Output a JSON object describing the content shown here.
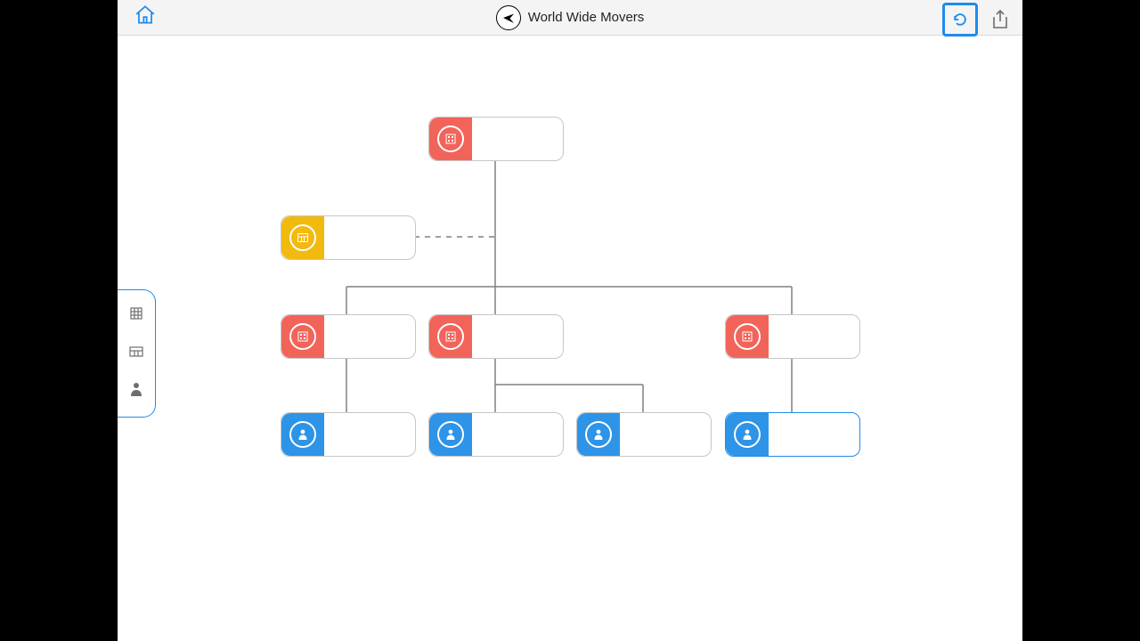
{
  "header": {
    "title": "World Wide Movers"
  },
  "palette": {
    "building_icon": "building-icon",
    "site_icon": "site-icon",
    "person_icon": "person-icon"
  },
  "nodes": {
    "root": {
      "type": "org",
      "color": "red",
      "label": ""
    },
    "assistant": {
      "type": "org",
      "color": "yellow",
      "label": ""
    },
    "dept_a": {
      "type": "org",
      "color": "red",
      "label": ""
    },
    "dept_b": {
      "type": "org",
      "color": "red",
      "label": ""
    },
    "dept_c": {
      "type": "org",
      "color": "red",
      "label": ""
    },
    "person_1": {
      "type": "person",
      "color": "blue",
      "label": ""
    },
    "person_2": {
      "type": "person",
      "color": "blue",
      "label": ""
    },
    "person_3": {
      "type": "person",
      "color": "blue",
      "label": ""
    },
    "person_4": {
      "type": "person",
      "color": "blue",
      "label": "",
      "selected": true
    }
  },
  "colors": {
    "accent": "#1f8bed",
    "red": "#f2645a",
    "yellow": "#f2b90f",
    "blue": "#2d94e8"
  }
}
